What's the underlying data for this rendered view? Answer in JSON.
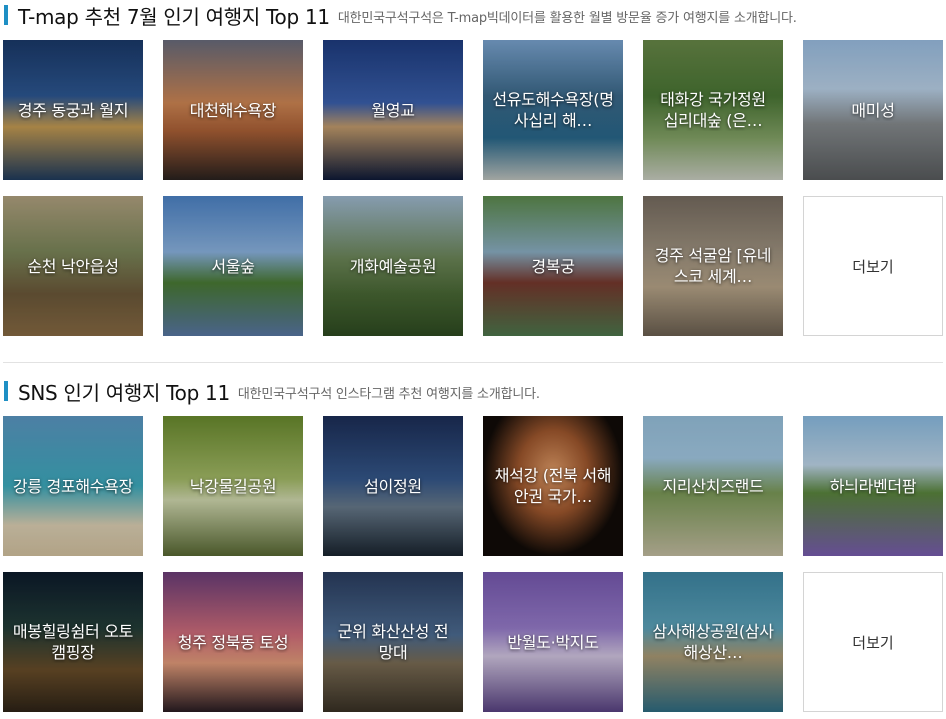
{
  "tmap": {
    "title": "T-map 추천 7월 인기 여행지 Top 11",
    "description": "대한민국구석구석은 T-map빅데이터를 활용한 월별 방문율 증가 여행지를 소개합니다.",
    "items": [
      {
        "label": "경주 동궁과 월지"
      },
      {
        "label": "대천해수욕장"
      },
      {
        "label": "월영교"
      },
      {
        "label": "선유도해수욕장(명사십리 해…"
      },
      {
        "label": "태화강 국가정원 십리대숲 (은…"
      },
      {
        "label": "매미성"
      },
      {
        "label": "순천 낙안읍성"
      },
      {
        "label": "서울숲"
      },
      {
        "label": "개화예술공원"
      },
      {
        "label": "경복궁"
      },
      {
        "label": "경주 석굴암 [유네스코 세계…"
      }
    ],
    "more_label": "더보기"
  },
  "sns": {
    "title": "SNS 인기 여행지 Top 11",
    "description": "대한민국구석구석 인스타그램 추천 여행지를 소개합니다.",
    "items": [
      {
        "label": "강릉 경포해수욕장"
      },
      {
        "label": "낙강물길공원"
      },
      {
        "label": "섬이정원"
      },
      {
        "label": "채석강 (전북 서해안권 국가…"
      },
      {
        "label": "지리산치즈랜드"
      },
      {
        "label": "하늬라벤더팜"
      },
      {
        "label": "매봉힐링쉼터 오토캠핑장"
      },
      {
        "label": "청주 정북동 토성"
      },
      {
        "label": "군위 화산산성 전망대"
      },
      {
        "label": "반월도·박지도"
      },
      {
        "label": "삼사해상공원(삼사해상산…"
      }
    ],
    "more_label": "더보기"
  },
  "colors": {
    "accent": "#1e8fc4",
    "divider": "#e2e2e2"
  }
}
